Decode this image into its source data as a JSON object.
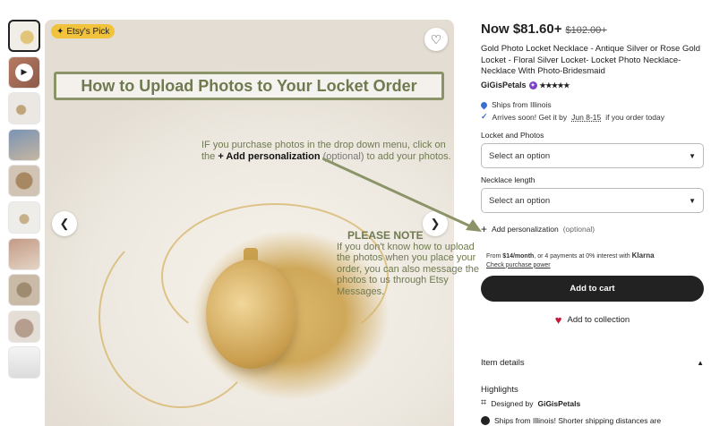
{
  "thumbnails": [
    {
      "name": "photo-1",
      "active": true
    },
    {
      "name": "video",
      "play": true
    },
    {
      "name": "photo-3"
    },
    {
      "name": "photo-4"
    },
    {
      "name": "photo-5"
    },
    {
      "name": "photo-6"
    },
    {
      "name": "photo-7"
    },
    {
      "name": "photo-8"
    },
    {
      "name": "photo-9"
    },
    {
      "name": "photo-10"
    }
  ],
  "gallery": {
    "badge": "Etsy's Pick",
    "banner": "How to Upload Photos to Your Locket Order",
    "instructions": {
      "line1": "IF you purchase photos in the drop down menu, click on",
      "prefix": "the",
      "action": "+ Add personalization",
      "optional": "(optional)",
      "suffix": "to add your photos."
    },
    "note_title": "PLEASE NOTE",
    "note_body": "If you don't know how to upload the photos when you place your order, you can also message the photos to us through Etsy Messages."
  },
  "product": {
    "price_now": "Now $81.60+",
    "price_old": "$102.00+",
    "title": "Gold Photo Locket Necklace - Antique Silver or Rose Gold Locket - Floral Silver Locket- Locket Photo Necklace- Necklace With Photo-Bridesmaid",
    "shop_name": "GiGisPetals",
    "rating_stars": "★★★★★",
    "ships_from": "Ships from Illinois",
    "arrives": {
      "prefix": "Arrives soon! Get it by",
      "dates": "Jun 8-15",
      "suffix": "if you order today"
    },
    "locket_label": "Locket and Photos",
    "locket_select": "Select an option",
    "length_label": "Necklace length",
    "length_select": "Select an option",
    "add_personalization": "Add personalization",
    "add_personalization_optional": "(optional)",
    "klarna": {
      "prefix": "From",
      "amount": "$14/month",
      "middle": ", or 4 payments at 0% interest with",
      "brand": "Klarna",
      "link": "Check purchase power"
    },
    "add_to_cart": "Add to cart",
    "add_to_collection": "Add to collection",
    "item_details": "Item details",
    "highlights": "Highlights",
    "designed_by_prefix": "Designed by",
    "designed_by_shop": "GiGisPetals",
    "ships_note": "Ships from Illinois! Shorter shipping distances are"
  },
  "colors": {
    "badge": "#f1c33c",
    "accent_text": "#6f7a50",
    "cart_button": "#222222",
    "heart": "#c4193a",
    "link_blue": "#3b6ecf"
  }
}
